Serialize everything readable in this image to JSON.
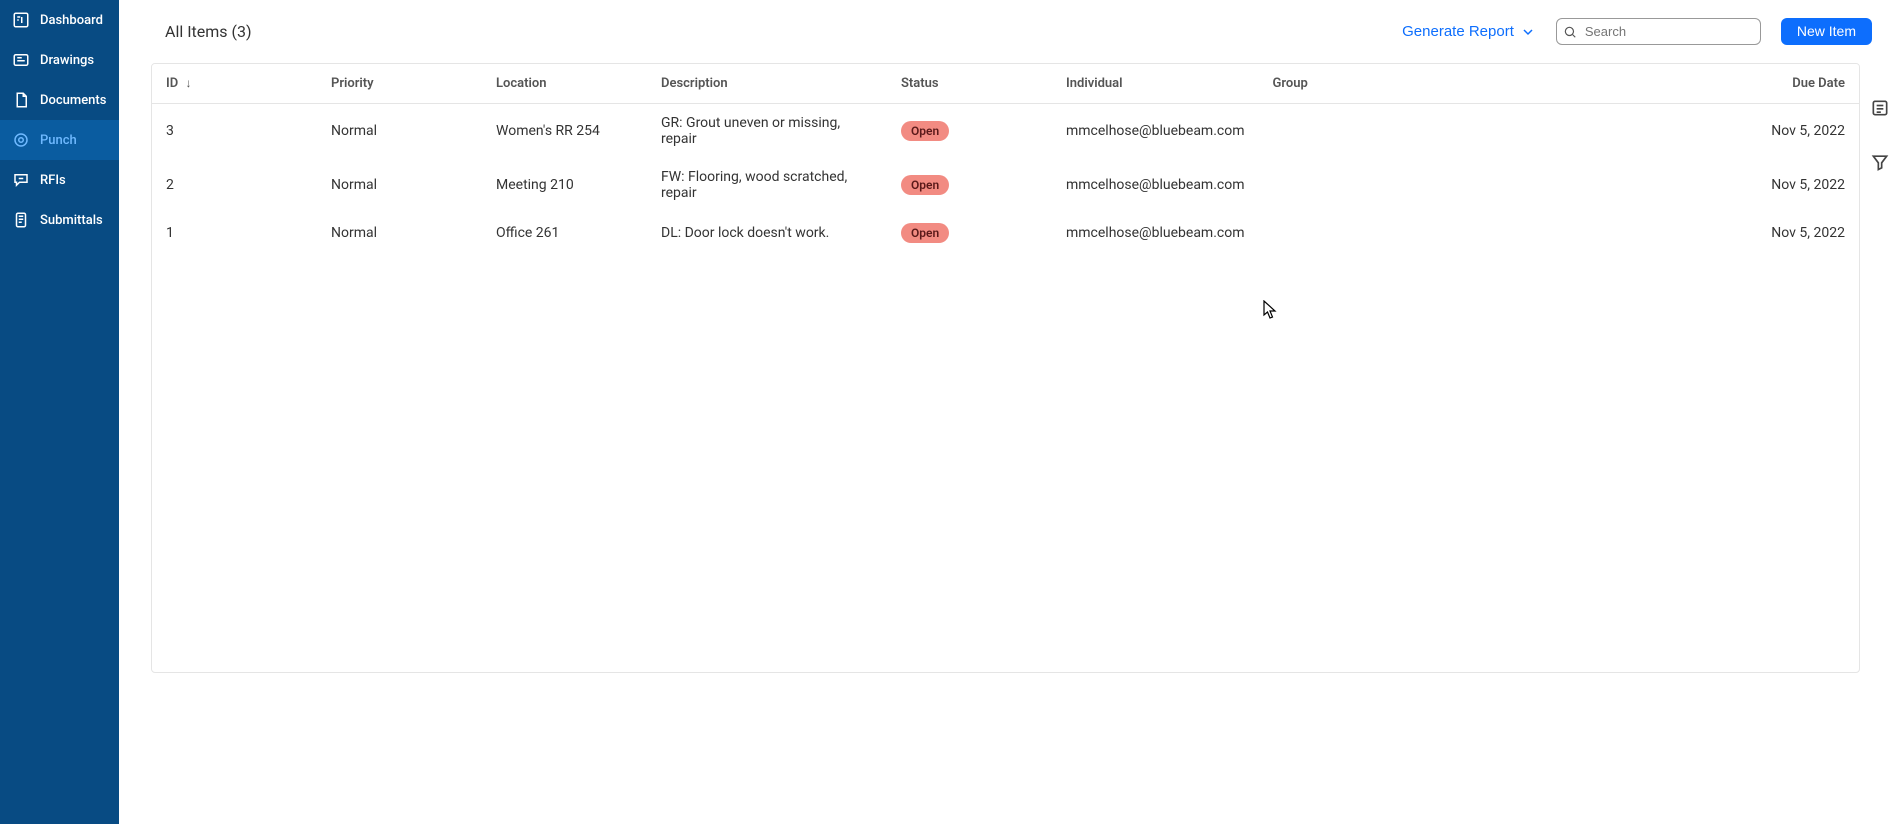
{
  "sidebar": {
    "items": [
      {
        "label": "Dashboard"
      },
      {
        "label": "Drawings"
      },
      {
        "label": "Documents"
      },
      {
        "label": "Punch"
      },
      {
        "label": "RFIs"
      },
      {
        "label": "Submittals"
      }
    ]
  },
  "header": {
    "title": "All Items (3)",
    "generate_report": "Generate Report",
    "search_placeholder": "Search",
    "new_item": "New Item"
  },
  "table": {
    "columns": {
      "id": "ID",
      "priority": "Priority",
      "location": "Location",
      "description": "Description",
      "status": "Status",
      "individual": "Individual",
      "group": "Group",
      "due_date": "Due Date"
    },
    "rows": [
      {
        "id": "3",
        "priority": "Normal",
        "location": "Women's RR 254",
        "description": "GR: Grout uneven or missing, repair",
        "status": "Open",
        "individual": "mmcelhose@bluebeam.com",
        "group": "",
        "due_date": "Nov 5, 2022"
      },
      {
        "id": "2",
        "priority": "Normal",
        "location": "Meeting 210",
        "description": "FW: Flooring, wood scratched, repair",
        "status": "Open",
        "individual": "mmcelhose@bluebeam.com",
        "group": "",
        "due_date": "Nov 5, 2022"
      },
      {
        "id": "1",
        "priority": "Normal",
        "location": "Office 261",
        "description": "DL: Door lock doesn't work.",
        "status": "Open",
        "individual": "mmcelhose@bluebeam.com",
        "group": "",
        "due_date": "Nov 5, 2022"
      }
    ]
  },
  "colors": {
    "sidebar_bg": "#084b83",
    "sidebar_active": "#0a5ca0",
    "accent": "#0d6efd",
    "status_open": "#f28b82"
  }
}
